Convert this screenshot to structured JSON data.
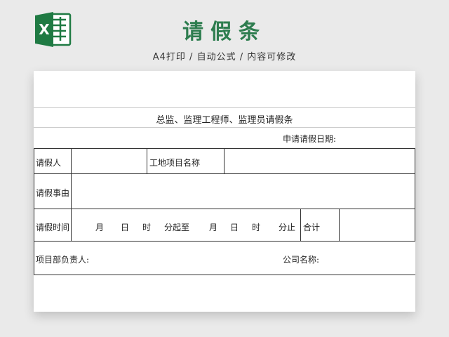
{
  "header": {
    "title": "请假条",
    "subtitle": "A4打印 / 自动公式 / 内容可修改",
    "logo_icon": "excel-icon",
    "logo_letter": "X",
    "logo_color": "#1f7a43"
  },
  "form": {
    "heading": "总监、监理工程师、监理员请假条",
    "apply_date_label": "申请请假日期:",
    "applicant_label": "请假人",
    "project_name_label": "工地项目名称",
    "reason_label": "请假事由",
    "time_label": "请假时间",
    "time_units": {
      "month_1": "月",
      "day_1": "日",
      "hour_1": "时",
      "minute_start": "分起至",
      "month_2": "月",
      "day_2": "日",
      "hour_2": "时",
      "minute_end": "分止"
    },
    "total_label": "合计",
    "manager_label": "项目部负责人:",
    "company_label": "公司名称:"
  }
}
